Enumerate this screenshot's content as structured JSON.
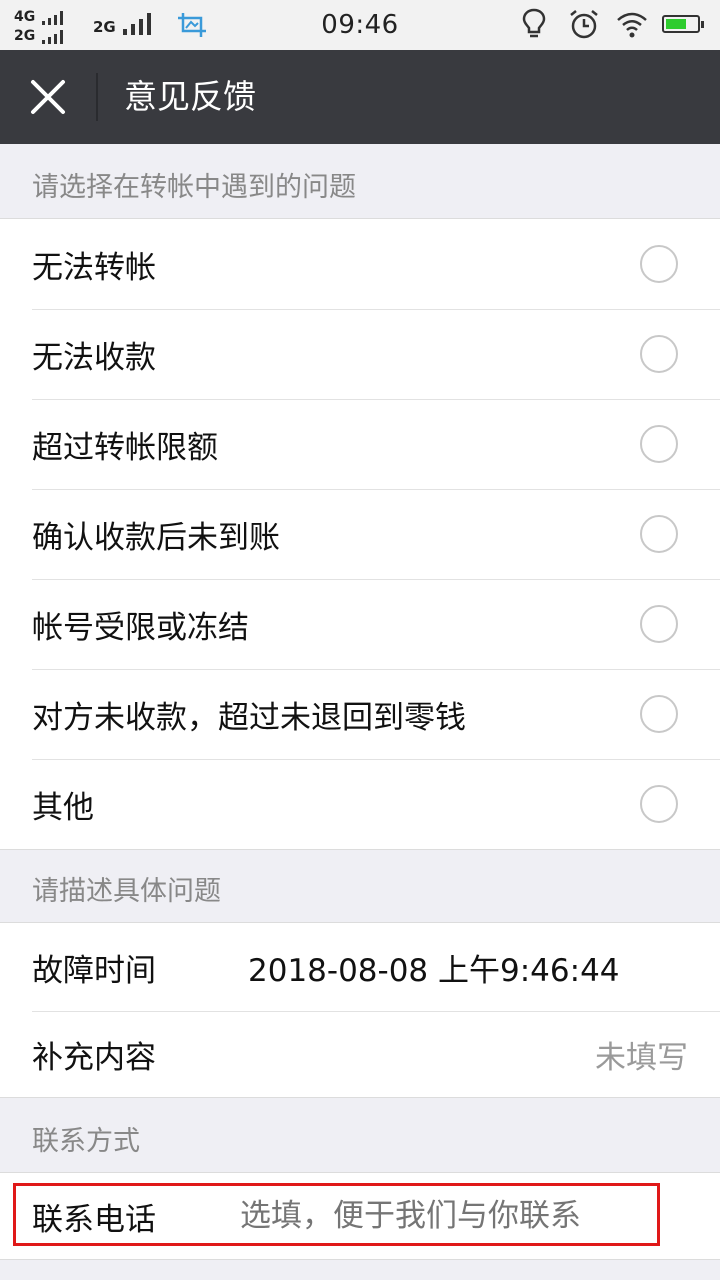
{
  "status_bar": {
    "network_1": "4G",
    "network_2": "2G",
    "network_3": "2G",
    "time": "09:46",
    "icons": [
      "signal-icon",
      "crop-icon",
      "lightbulb-icon",
      "alarm-icon",
      "wifi-icon",
      "battery-icon"
    ],
    "battery_color": "#2ecc2e"
  },
  "title_bar": {
    "title": "意见反馈",
    "background": "#393a3f"
  },
  "section_problem": {
    "header": "请选择在转帐中遇到的问题",
    "options": [
      {
        "label": "无法转帐",
        "selected": false
      },
      {
        "label": "无法收款",
        "selected": false
      },
      {
        "label": "超过转帐限额",
        "selected": false
      },
      {
        "label": "确认收款后未到账",
        "selected": false
      },
      {
        "label": "帐号受限或冻结",
        "selected": false
      },
      {
        "label": "对方未收款，超过未退回到零钱",
        "selected": false
      },
      {
        "label": "其他",
        "selected": false
      }
    ]
  },
  "section_describe": {
    "header": "请描述具体问题",
    "fault_time_label": "故障时间",
    "fault_time_value": "2018-08-08 上午9:46:44",
    "supplement_label": "补充内容",
    "supplement_value": "未填写"
  },
  "section_contact": {
    "header": "联系方式",
    "phone_label": "联系电话",
    "phone_placeholder": "选填，便于我们与你联系"
  },
  "highlight_color": "#e01818"
}
